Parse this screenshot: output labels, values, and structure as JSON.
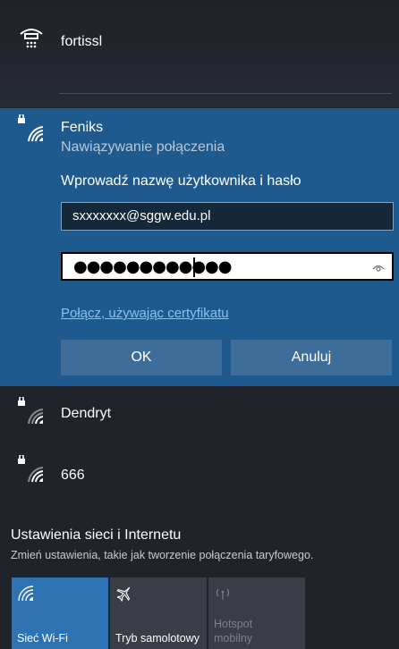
{
  "networks": [
    {
      "name": "fortissl",
      "icon": "phone-wifi-icon"
    },
    {
      "name": "Feniks",
      "status": "Nawiązywanie połączenia",
      "icon": "secured-wifi-icon"
    },
    {
      "name": "Dendryt",
      "icon": "secured-wifi-icon"
    },
    {
      "name": "666",
      "icon": "secured-wifi-icon"
    }
  ],
  "login": {
    "prompt": "Wprowadź nazwę użytkownika i hasło",
    "username_value": "sxxxxxxx@sggw.edu.pl",
    "password_masked": "●●●●●●●●●●●●",
    "cert_link": "Połącz, używając certyfikatu",
    "ok_label": "OK",
    "cancel_label": "Anuluj"
  },
  "settings": {
    "title": "Ustawienia sieci i Internetu",
    "description": "Zmień ustawienia, takie jak tworzenie połączenia taryfowego."
  },
  "quick_actions": [
    {
      "label": "Sieć Wi-Fi",
      "state": "on",
      "icon": "wifi-icon"
    },
    {
      "label": "Tryb samolotowy",
      "state": "off",
      "icon": "airplane-icon"
    },
    {
      "label": "Hotspot mobilny",
      "state": "disabled",
      "icon": "hotspot-icon"
    }
  ],
  "colors": {
    "background": "#20232a",
    "accent_panel": "#1f5a8e",
    "accent_tile": "#2d73b3",
    "link": "#8cc0ec"
  }
}
